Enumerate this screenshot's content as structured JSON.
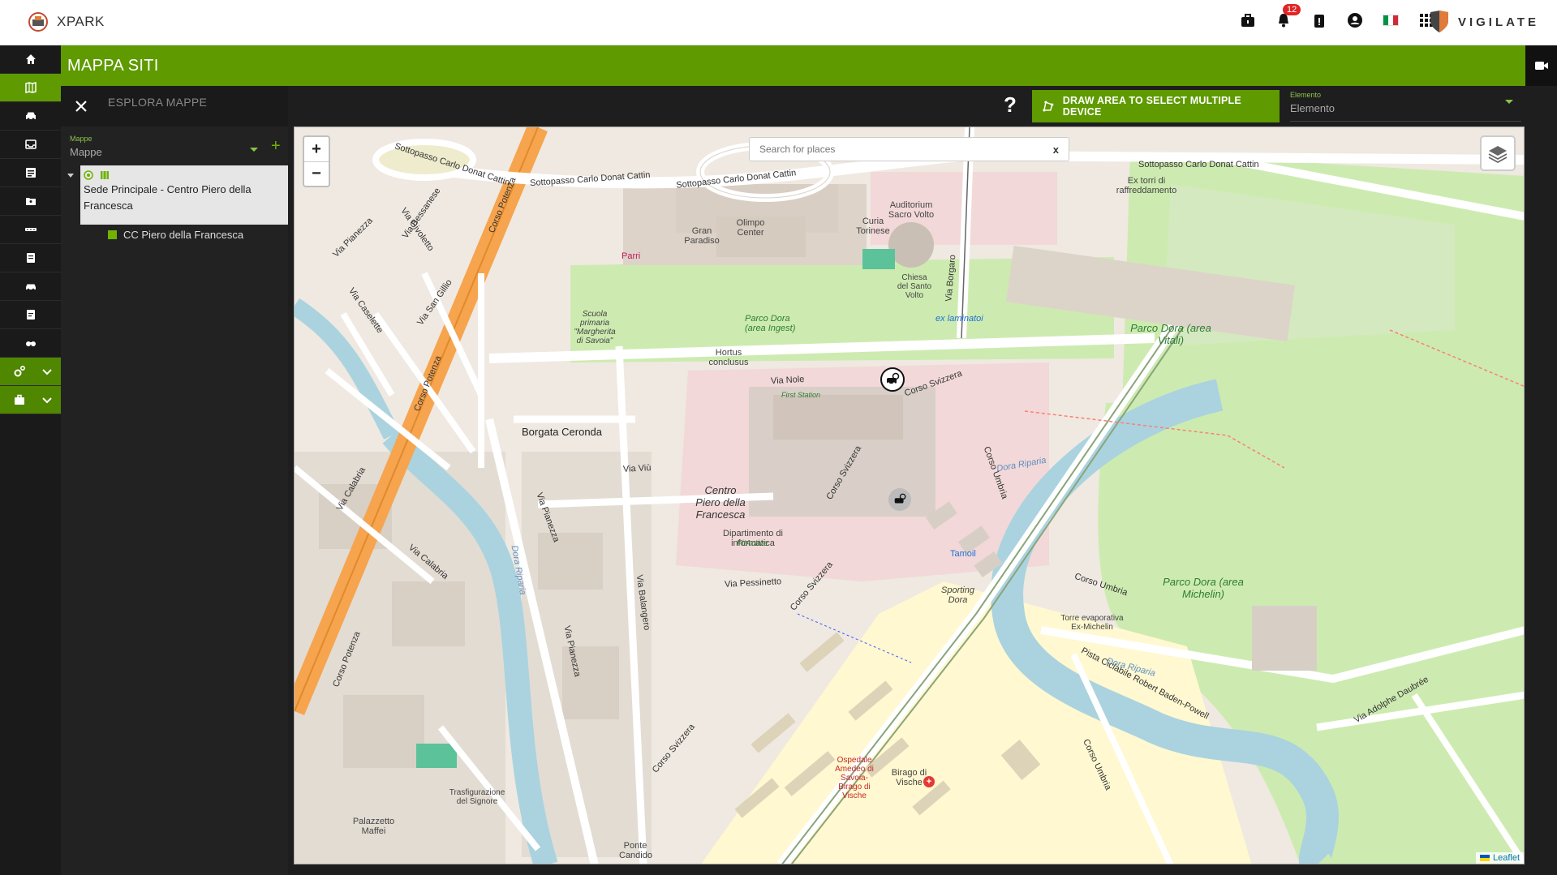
{
  "app": {
    "name": "XPARK",
    "notification_count": "12",
    "partner": "VIGILATE"
  },
  "header": {
    "title": "MAPPA SITI"
  },
  "panel": {
    "title": "ESPLORA MAPPE",
    "select_label": "Mappe",
    "select_value": "Mappe",
    "tree": {
      "root_label": "Sede Principale - Centro Piero della Francesca",
      "child_label": "CC Piero della Francesca"
    }
  },
  "toolbar": {
    "help_label": "?",
    "draw_button_label": "DRAW AREA TO SELECT MULTIPLE DEVICE",
    "element_label": "Elemento",
    "element_value": "Elemento"
  },
  "map": {
    "zoom_in": "+",
    "zoom_out": "−",
    "search_placeholder": "Search for places",
    "search_clear": "x",
    "attribution": "Leaflet",
    "labels": {
      "sottopasso1": "Sottopasso Carlo Donat Cattin",
      "sottopasso2": "Sottopasso Carlo Donat Cattin",
      "sottopasso3": "Sottopasso Carlo Donat Cattin",
      "sottopasso4": "Sottopasso Carlo Donat Cattin",
      "corso_potenza": "Corso Potenza",
      "via_nole": "Via Nole",
      "via_viu": "Via Viù",
      "via_pessinetto": "Via Pessinetto",
      "via_balangero": "Via Balangero",
      "via_pianezza": "Via Pianezza",
      "corso_svizzera": "Corso Svizzera",
      "corso_umbria": "Corso Umbria",
      "via_borgaro": "Via Borgaro",
      "via_calabria": "Via Calabria",
      "via_caselette": "Via Caselette",
      "via_givoletto": "Via Givoletto",
      "via_san_gillio": "Via San Gillio",
      "via_bessanese": "Via Bessanese",
      "via_adolphe": "Via Adolphe Daubrée",
      "pista": "Pista Ciclabile Robert Baden-Powell",
      "borgata": "Borgata Ceronda",
      "centro": "Centro Piero della Francesca",
      "dipartimento": "Dipartimento di informatica",
      "parco_ingest": "Parco Dora (area Ingest)",
      "parco_vitali": "Parco Dora (area Vitali)",
      "parco_michelin": "Parco Dora (area Michelin)",
      "dora1": "Dora Riparia",
      "dora2": "Dora Riparia",
      "dora3": "Dora Riparia",
      "auditorium": "Auditorium Sacro Volto",
      "chiesa": "Chiesa del Santo Volto",
      "curia": "Curia Torinese",
      "olimpo": "Olimpo Center",
      "gran_paradiso": "Gran Paradiso",
      "scuola": "Scuola primaria \"Margherita di Savoia\"",
      "hortus": "Hortus conclusus",
      "ospedale": "Ospedale Amedeo di Savoia-Birago di Vische",
      "birago": "Birago di Vische",
      "sporting": "Sporting Dora",
      "torre": "Torre evaporativa Ex-Michelin",
      "torri": "Ex torri di raffreddamento",
      "trasfigurazione": "Trasfigurazione del Signore",
      "palazzetto": "Palazzetto Maffei",
      "ponte": "Ponte Candido",
      "tamoil": "Tamoil",
      "fitactive": "FitActive",
      "piazza_parri": "Parri",
      "ex_laminatoi": "ex laminatoi",
      "first_station": "First Station"
    }
  },
  "colors": {
    "accent": "#5e9a00",
    "rail": "#1a1a1a",
    "badge": "#e02424",
    "park": "#cdebb0",
    "road_major": "#f7a44e",
    "water": "#aad3df"
  }
}
